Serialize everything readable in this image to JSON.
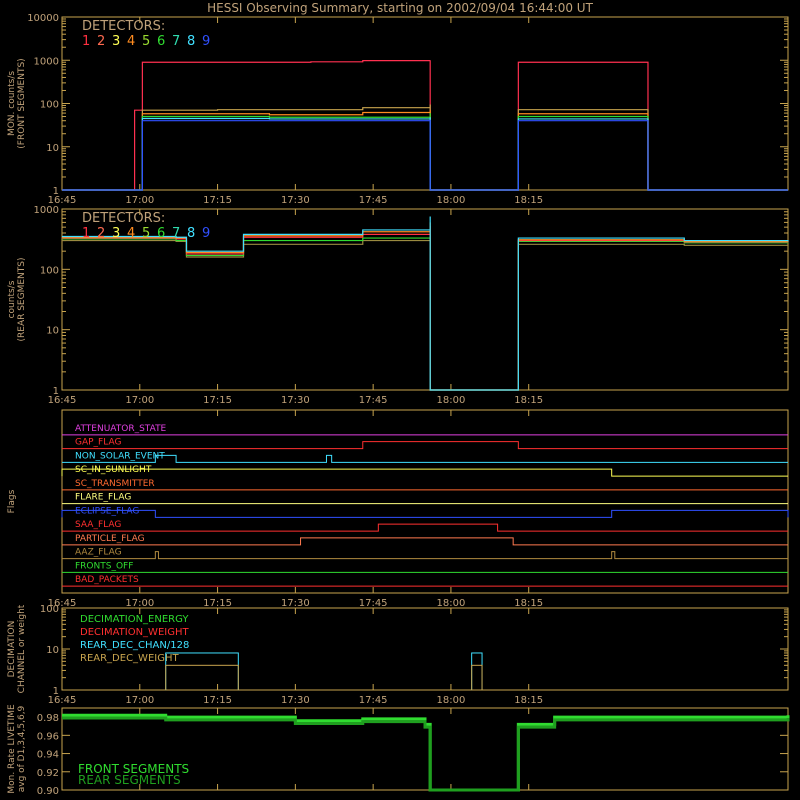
{
  "title": "HESSI Observing Summary, starting on 2002/09/04 16:44:00 UT",
  "colors": {
    "frame": "#c8a44e",
    "text": "#c0a27a",
    "det": [
      "#ff3040",
      "#ff6a50",
      "#ffff55",
      "#ff8c20",
      "#9adc30",
      "#30dc30",
      "#30dcb0",
      "#40e0ff",
      "#3050ff"
    ]
  },
  "time_ticks": [
    "16:45",
    "17:00",
    "17:15",
    "17:30",
    "17:45",
    "18:00",
    "18:15"
  ],
  "chart_data": [
    {
      "type": "line",
      "name": "front",
      "ylabel": "MON. counts/s\n(FRONT SEGMENTS)",
      "ylog": true,
      "ylim": [
        1,
        10000
      ],
      "yticks": [
        "1",
        "10",
        "100",
        "1000",
        "10000"
      ],
      "xlim_min": [
        0,
        100
      ],
      "legend_title": "DETECTORS:",
      "legend_items": [
        "1",
        "2",
        "3",
        "4",
        "5",
        "6",
        "7",
        "8",
        "9"
      ],
      "series": [
        {
          "color": "#ff3050",
          "points": [
            [
              0,
              1
            ],
            [
              14,
              1
            ],
            [
              14,
              70
            ],
            [
              15.5,
              70
            ],
            [
              15.5,
              900
            ],
            [
              48,
              920
            ],
            [
              58,
              980
            ],
            [
              71,
              1000
            ],
            [
              71,
              1
            ],
            [
              88,
              1
            ],
            [
              88,
              900
            ],
            [
              113,
              900
            ],
            [
              113,
              1
            ],
            [
              140,
              1
            ]
          ]
        },
        {
          "color": "#c8a44e",
          "points": [
            [
              0,
              1
            ],
            [
              15.5,
              1
            ],
            [
              15.5,
              70
            ],
            [
              30,
              72
            ],
            [
              58,
              80
            ],
            [
              71,
              95
            ],
            [
              71,
              1
            ],
            [
              88,
              1
            ],
            [
              88,
              72
            ],
            [
              113,
              68
            ],
            [
              113,
              1
            ],
            [
              140,
              1
            ]
          ]
        },
        {
          "color": "#ff8c20",
          "points": [
            [
              0,
              1
            ],
            [
              15.5,
              1
            ],
            [
              15.5,
              58
            ],
            [
              40,
              55
            ],
            [
              58,
              62
            ],
            [
              71,
              70
            ],
            [
              71,
              1
            ],
            [
              88,
              1
            ],
            [
              88,
              58
            ],
            [
              113,
              55
            ],
            [
              113,
              1
            ],
            [
              140,
              1
            ]
          ]
        },
        {
          "color": "#30dc30",
          "points": [
            [
              0,
              1
            ],
            [
              15.5,
              1
            ],
            [
              15.5,
              50
            ],
            [
              40,
              48
            ],
            [
              71,
              60
            ],
            [
              71,
              1
            ],
            [
              88,
              1
            ],
            [
              88,
              50
            ],
            [
              113,
              48
            ],
            [
              113,
              1
            ],
            [
              140,
              1
            ]
          ]
        },
        {
          "color": "#40e0ff",
          "points": [
            [
              0,
              1
            ],
            [
              15.5,
              1
            ],
            [
              15.5,
              45
            ],
            [
              40,
              44
            ],
            [
              71,
              48
            ],
            [
              71,
              1
            ],
            [
              88,
              1
            ],
            [
              88,
              44
            ],
            [
              113,
              40
            ],
            [
              113,
              1
            ],
            [
              140,
              1
            ]
          ]
        },
        {
          "color": "#3050ff",
          "points": [
            [
              0,
              1
            ],
            [
              15.5,
              1
            ],
            [
              15.5,
              40
            ],
            [
              40,
              40
            ],
            [
              71,
              42
            ],
            [
              71,
              1
            ],
            [
              88,
              1
            ],
            [
              88,
              40
            ],
            [
              113,
              38
            ],
            [
              113,
              1
            ],
            [
              140,
              1
            ]
          ]
        }
      ]
    },
    {
      "type": "line",
      "name": "rear",
      "ylabel": "counts/s\n(REAR SEGMENTS)",
      "ylog": true,
      "ylim": [
        1,
        1000
      ],
      "yticks": [
        "1",
        "10",
        "100",
        "1000"
      ],
      "legend_title": "DETECTORS:",
      "legend_items": [
        "1",
        "2",
        "3",
        "4",
        "5",
        "6",
        "7",
        "8",
        "9"
      ],
      "series": [
        {
          "color": "#9a8a40",
          "points": [
            [
              0,
              300
            ],
            [
              22,
              290
            ],
            [
              24,
              160
            ],
            [
              35,
              170
            ],
            [
              35,
              260
            ],
            [
              58,
              300
            ],
            [
              71,
              330
            ],
            [
              71,
              1
            ],
            [
              88,
              1
            ],
            [
              88,
              260
            ],
            [
              120,
              250
            ],
            [
              140,
              250
            ]
          ]
        },
        {
          "color": "#30dc30",
          "points": [
            [
              0,
              320
            ],
            [
              22,
              300
            ],
            [
              24,
              170
            ],
            [
              35,
              180
            ],
            [
              35,
              300
            ],
            [
              58,
              330
            ],
            [
              71,
              380
            ],
            [
              71,
              1
            ],
            [
              88,
              1
            ],
            [
              88,
              290
            ],
            [
              120,
              275
            ],
            [
              140,
              270
            ]
          ]
        },
        {
          "color": "#ff3040",
          "points": [
            [
              0,
              330
            ],
            [
              22,
              320
            ],
            [
              24,
              180
            ],
            [
              35,
              190
            ],
            [
              35,
              340
            ],
            [
              58,
              380
            ],
            [
              71,
              520
            ],
            [
              71,
              1
            ],
            [
              88,
              1
            ],
            [
              88,
              300
            ],
            [
              120,
              285
            ],
            [
              140,
              280
            ]
          ]
        },
        {
          "color": "#ff8c20",
          "points": [
            [
              0,
              340
            ],
            [
              22,
              330
            ],
            [
              24,
              190
            ],
            [
              35,
              195
            ],
            [
              35,
              360
            ],
            [
              58,
              420
            ],
            [
              71,
              600
            ],
            [
              71,
              1
            ],
            [
              88,
              1
            ],
            [
              88,
              310
            ],
            [
              120,
              290
            ],
            [
              140,
              285
            ]
          ]
        },
        {
          "color": "#40e0ff",
          "points": [
            [
              0,
              350
            ],
            [
              22,
              340
            ],
            [
              24,
              200
            ],
            [
              35,
              210
            ],
            [
              35,
              380
            ],
            [
              58,
              450
            ],
            [
              71,
              750
            ],
            [
              71,
              1
            ],
            [
              88,
              1
            ],
            [
              88,
              330
            ],
            [
              120,
              300
            ],
            [
              140,
              290
            ]
          ]
        }
      ]
    },
    {
      "type": "step",
      "name": "flags",
      "ylabel": "Flags",
      "items": [
        {
          "label": "ATTENUATOR_STATE",
          "color": "#e040e0",
          "steps": []
        },
        {
          "label": "GAP_FLAG",
          "color": "#ff3030",
          "steps": [
            [
              58,
              88
            ]
          ]
        },
        {
          "label": "NON_SOLAR_EVENT",
          "color": "#40e0ff",
          "steps": [
            [
              18,
              22
            ],
            [
              51,
              52
            ]
          ]
        },
        {
          "label": "SC_IN_SUNLIGHT",
          "color": "#ffff55",
          "steps": [
            [
              0,
              106
            ]
          ]
        },
        {
          "label": "SC_TRANSMITTER",
          "color": "#ff6a30",
          "steps": []
        },
        {
          "label": "FLARE_FLAG",
          "color": "#ffff80",
          "steps": []
        },
        {
          "label": "ECLIPSE_FLAG",
          "color": "#3050ff",
          "steps": [
            [
              0,
              18
            ],
            [
              106,
              140
            ]
          ]
        },
        {
          "label": "SAA_FLAG",
          "color": "#ff3030",
          "steps": [
            [
              61,
              84
            ]
          ]
        },
        {
          "label": "PARTICLE_FLAG",
          "color": "#ff7a50",
          "steps": [
            [
              46,
              87
            ]
          ]
        },
        {
          "label": "AAZ_FLAG",
          "color": "#b08a40",
          "steps": [
            [
              18,
              18.6
            ],
            [
              106,
              106.6
            ]
          ]
        },
        {
          "label": "FRONTS_OFF",
          "color": "#30dc30",
          "steps": []
        },
        {
          "label": "BAD_PACKETS",
          "color": "#ff3030",
          "steps": []
        }
      ]
    },
    {
      "type": "step",
      "name": "decimation",
      "ylabel": "DECIMATION\nCHANNEL or weight",
      "ylog": true,
      "ylim": [
        1,
        100
      ],
      "yticks": [
        "1",
        "10",
        "100"
      ],
      "legend": [
        {
          "label": "DECIMATION_ENERGY",
          "color": "#30dc30"
        },
        {
          "label": "DECIMATION_WEIGHT",
          "color": "#ff3030"
        },
        {
          "label": "REAR_DEC_CHAN/128",
          "color": "#40e0ff"
        },
        {
          "label": "REAR_DEC_WEIGHT",
          "color": "#c8a44e"
        }
      ],
      "series": [
        {
          "color": "#40e0ff",
          "boxes": [
            [
              20,
              34,
              8
            ],
            [
              79,
              81,
              8
            ]
          ]
        },
        {
          "color": "#c8a44e",
          "boxes": [
            [
              20,
              34,
              4
            ],
            [
              79,
              81,
              4
            ]
          ]
        }
      ]
    },
    {
      "type": "line",
      "name": "livetime",
      "ylabel": "Mon. Rate LIVETIME\navg of D1,3,4,5,6,9",
      "ylim": [
        0.9,
        0.99
      ],
      "yticks": [
        "0.90",
        "0.92",
        "0.94",
        "0.96",
        "0.98"
      ],
      "legend": [
        {
          "label": "FRONT SEGMENTS",
          "color": "#30dc30"
        },
        {
          "label": "REAR SEGMENTS",
          "color": "#1f9f1f"
        }
      ],
      "series": [
        {
          "color": "#30dc30",
          "points": [
            [
              0,
              0.982
            ],
            [
              20,
              0.98
            ],
            [
              45,
              0.976
            ],
            [
              58,
              0.978
            ],
            [
              70,
              0.972
            ],
            [
              71,
              0.9
            ],
            [
              88,
              0.9
            ],
            [
              88,
              0.972
            ],
            [
              95,
              0.98
            ],
            [
              140,
              0.982
            ]
          ]
        },
        {
          "color": "#1f9f1f",
          "points": [
            [
              0,
              0.979
            ],
            [
              20,
              0.977
            ],
            [
              45,
              0.973
            ],
            [
              58,
              0.975
            ],
            [
              70,
              0.969
            ],
            [
              71,
              0.9
            ],
            [
              88,
              0.9
            ],
            [
              88,
              0.969
            ],
            [
              95,
              0.977
            ],
            [
              140,
              0.979
            ]
          ]
        }
      ]
    }
  ]
}
